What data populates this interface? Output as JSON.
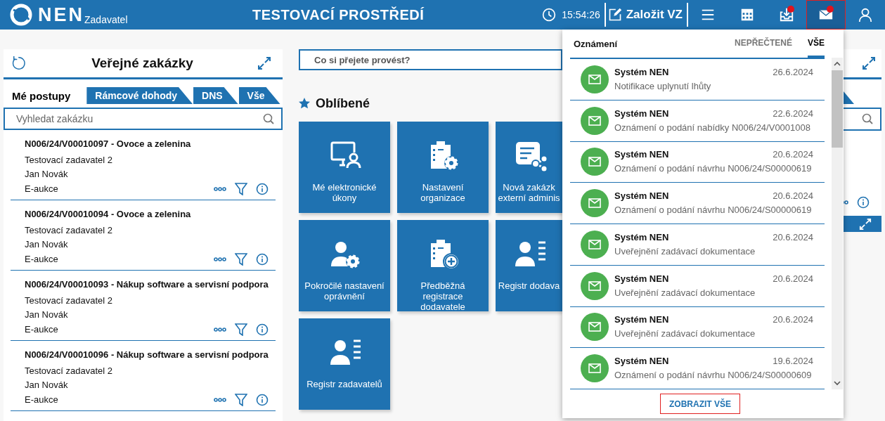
{
  "header": {
    "logo": "NEN",
    "role": "Zadavatel",
    "environment": "TESTOVACÍ PROSTŘEDÍ",
    "time": "15:54:26",
    "create_button": "Založit VZ",
    "toolbar": [
      {
        "kind": "menu",
        "badge": false,
        "selected": false
      },
      {
        "kind": "calendar",
        "badge": false,
        "selected": false
      },
      {
        "kind": "inbox",
        "badge": true,
        "selected": false
      },
      {
        "kind": "mail",
        "badge": true,
        "selected": true
      },
      {
        "kind": "user",
        "badge": false,
        "selected": false
      }
    ]
  },
  "contracts_panel": {
    "title": "Veřejné zakázky",
    "tabs": [
      {
        "label": "Mé postupy",
        "selected": true
      },
      {
        "label": "Rámcové dohody",
        "selected": false
      },
      {
        "label": "DNS",
        "selected": false
      },
      {
        "label": "Vše",
        "selected": false
      }
    ],
    "search": {
      "placeholder": "Vyhledat zakázku"
    },
    "items": [
      {
        "title": "N006/24/V00010097 - Ovoce a zelenina",
        "organization": "Testovací zadavatel 2",
        "person": "Jan Novák",
        "type": "E-aukce"
      },
      {
        "title": "N006/24/V00010094 - Ovoce a zelenina",
        "organization": "Testovací zadavatel 2",
        "person": "Jan Novák",
        "type": "E-aukce"
      },
      {
        "title": "N006/24/V00010093 - Nákup software a servisní podpora",
        "organization": "Testovací zadavatel 2",
        "person": "Jan Novák",
        "type": "E-aukce"
      },
      {
        "title": "N006/24/V00010096 - Nákup software a servisní podpora",
        "organization": "Testovací zadavatel 2",
        "person": "Jan Novák",
        "type": "E-aukce"
      }
    ]
  },
  "command_search": {
    "placeholder": "Co si přejete provést?"
  },
  "favorites": {
    "title": "Oblíbené",
    "tiles": [
      {
        "kind": "monitor-user",
        "lines": [
          "Mé elektronické",
          "úkony"
        ]
      },
      {
        "kind": "building-gear",
        "lines": [
          "Nastavení",
          "organizace"
        ]
      },
      {
        "kind": "document-share",
        "lines": [
          "Nová zakázk",
          "externí adminis"
        ]
      },
      {
        "kind": "user-gear",
        "lines": [
          "Pokročilé nastavení",
          "oprávnění"
        ]
      },
      {
        "kind": "building-plus",
        "lines": [
          "Předběžná",
          "registrace",
          "dodavatele"
        ]
      },
      {
        "kind": "user-list",
        "lines": [
          "Registr dodava"
        ]
      },
      {
        "kind": "user-list",
        "lines": [
          "Registr zadavatelů"
        ]
      }
    ]
  },
  "notifications": {
    "title": "Oznámení",
    "tabs": [
      {
        "label": "NEPŘEČTENÉ",
        "selected": false
      },
      {
        "label": "VŠE",
        "selected": true
      }
    ],
    "items": [
      {
        "sender": "Systém NEN",
        "date": "26.6.2024",
        "text": "Notifikace uplynutí lhůty"
      },
      {
        "sender": "Systém NEN",
        "date": "22.6.2024",
        "text": "Oznámení o podání nabídky N006/24/V0001008"
      },
      {
        "sender": "Systém NEN",
        "date": "20.6.2024",
        "text": "Oznámení o podání návrhu N006/24/S00000619"
      },
      {
        "sender": "Systém NEN",
        "date": "20.6.2024",
        "text": "Oznámení o podání návrhu N006/24/S00000619"
      },
      {
        "sender": "Systém NEN",
        "date": "20.6.2024",
        "text": "Uveřejnění zadávací dokumentace"
      },
      {
        "sender": "Systém NEN",
        "date": "20.6.2024",
        "text": "Uveřejnění zadávací dokumentace"
      },
      {
        "sender": "Systém NEN",
        "date": "20.6.2024",
        "text": "Uveřejnění zadávací dokumentace"
      },
      {
        "sender": "Systém NEN",
        "date": "19.6.2024",
        "text": "Oznámení o podání návrhu N006/24/S00000609"
      }
    ],
    "show_all": "ZOBRAZIT VŠE"
  }
}
